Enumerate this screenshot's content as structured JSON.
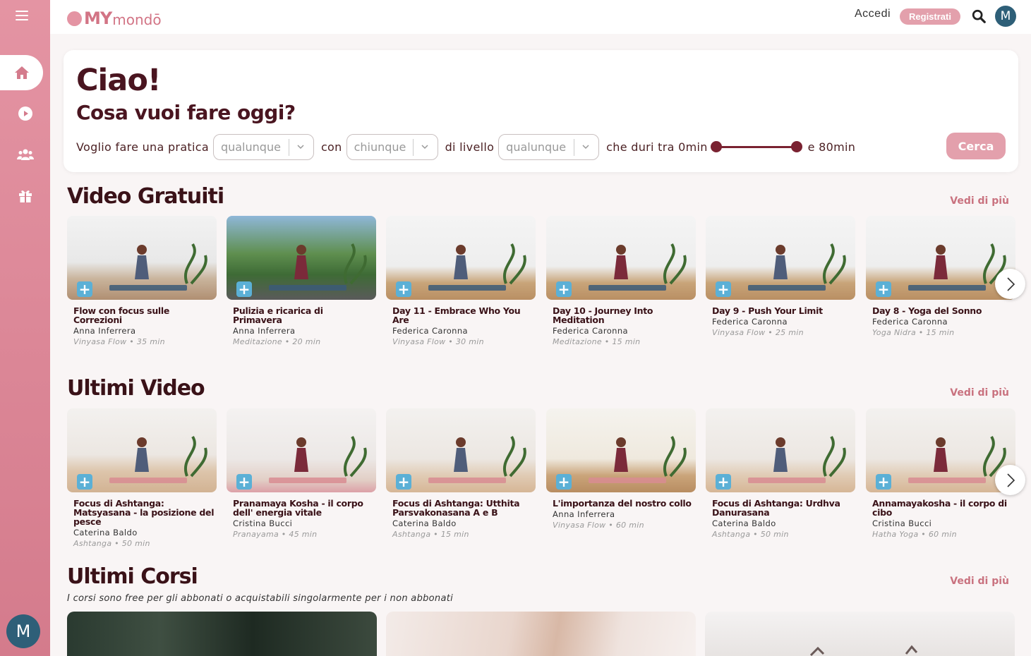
{
  "brand": {
    "my": "MY",
    "mondo": "mondō",
    "accent": "#e494a3"
  },
  "topbar": {
    "login": "Accedi",
    "register": "Registrati",
    "avatar_initial": "M"
  },
  "sidebar": {
    "items": [
      "home-icon",
      "play-icon",
      "community-icon",
      "gift-icon"
    ],
    "avatar_initial": "M"
  },
  "hero": {
    "greeting": "Ciao!",
    "question": "Cosa vuoi fare oggi?",
    "filters": {
      "t1": "Voglio fare una pratica",
      "practice": "qualunque",
      "t2": "con",
      "teacher": "chiunque",
      "t3": "di livello",
      "level": "qualunque",
      "t4": "che duri tra 0min",
      "t5": "e 80min"
    },
    "search_button": "Cerca"
  },
  "free_videos": {
    "title": "Video Gratuiti",
    "see_more": "Vedi di più",
    "items": [
      {
        "title": "Flow con focus sulle Correzioni",
        "author": "Anna Inferrera",
        "meta": "Vinyasa Flow • 35 min"
      },
      {
        "title": "Pulizia e ricarica di Primavera",
        "author": "Anna Inferrera",
        "meta": "Meditazione • 20 min"
      },
      {
        "title": "Day 11 - Embrace Who You Are",
        "author": "Federica Caronna",
        "meta": "Vinyasa Flow • 30 min"
      },
      {
        "title": "Day 10 - Journey Into Meditation",
        "author": "Federica Caronna",
        "meta": "Meditazione • 15 min"
      },
      {
        "title": "Day 9 - Push Your Limit",
        "author": "Federica Caronna",
        "meta": "Vinyasa Flow • 25 min"
      },
      {
        "title": "Day 8 - Yoga del Sonno",
        "author": "Federica Caronna",
        "meta": "Yoga Nidra • 15 min"
      }
    ]
  },
  "latest_videos": {
    "title": "Ultimi Video",
    "see_more": "Vedi di più",
    "items": [
      {
        "title": "Focus di Ashtanga: Matsyasana - la posizione del pesce",
        "author": "Caterina Baldo",
        "meta": "Ashtanga • 50 min"
      },
      {
        "title": "Pranamaya Kosha - il corpo dell' energia vitale",
        "author": "Cristina Bucci",
        "meta": "Pranayama • 45 min"
      },
      {
        "title": "Focus di Ashtanga: Utthita Parsvakonasana A e B",
        "author": "Caterina Baldo",
        "meta": "Ashtanga • 15 min"
      },
      {
        "title": "L'importanza del nostro collo",
        "author": "Anna Inferrera",
        "meta": "Vinyasa Flow • 60 min"
      },
      {
        "title": "Focus di Ashtanga: Urdhva Danurasana",
        "author": "Caterina Baldo",
        "meta": "Ashtanga • 50 min"
      },
      {
        "title": "Annamayakosha - il corpo di cibo",
        "author": "Cristina Bucci",
        "meta": "Hatha Yoga • 60 min"
      }
    ]
  },
  "latest_courses": {
    "title": "Ultimi Corsi",
    "see_more": "Vedi di più",
    "subtitle": "I corsi sono free per gli abbonati o acquistabili singolarmente per i non abbonati"
  }
}
